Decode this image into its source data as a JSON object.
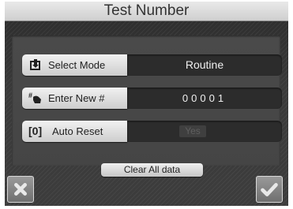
{
  "title": "Test Number",
  "rows": [
    {
      "label": "Select Mode",
      "icon": "select-mode-icon",
      "value": "Routine"
    },
    {
      "label": "Enter New #",
      "icon": "enter-number-icon",
      "value": "00001"
    },
    {
      "label": "Auto Reset",
      "icon": "[0]",
      "value": "Yes"
    }
  ],
  "clear_button": "Clear All data",
  "buttons": {
    "cancel_icon": "close-icon",
    "ok_icon": "checkmark-icon"
  }
}
